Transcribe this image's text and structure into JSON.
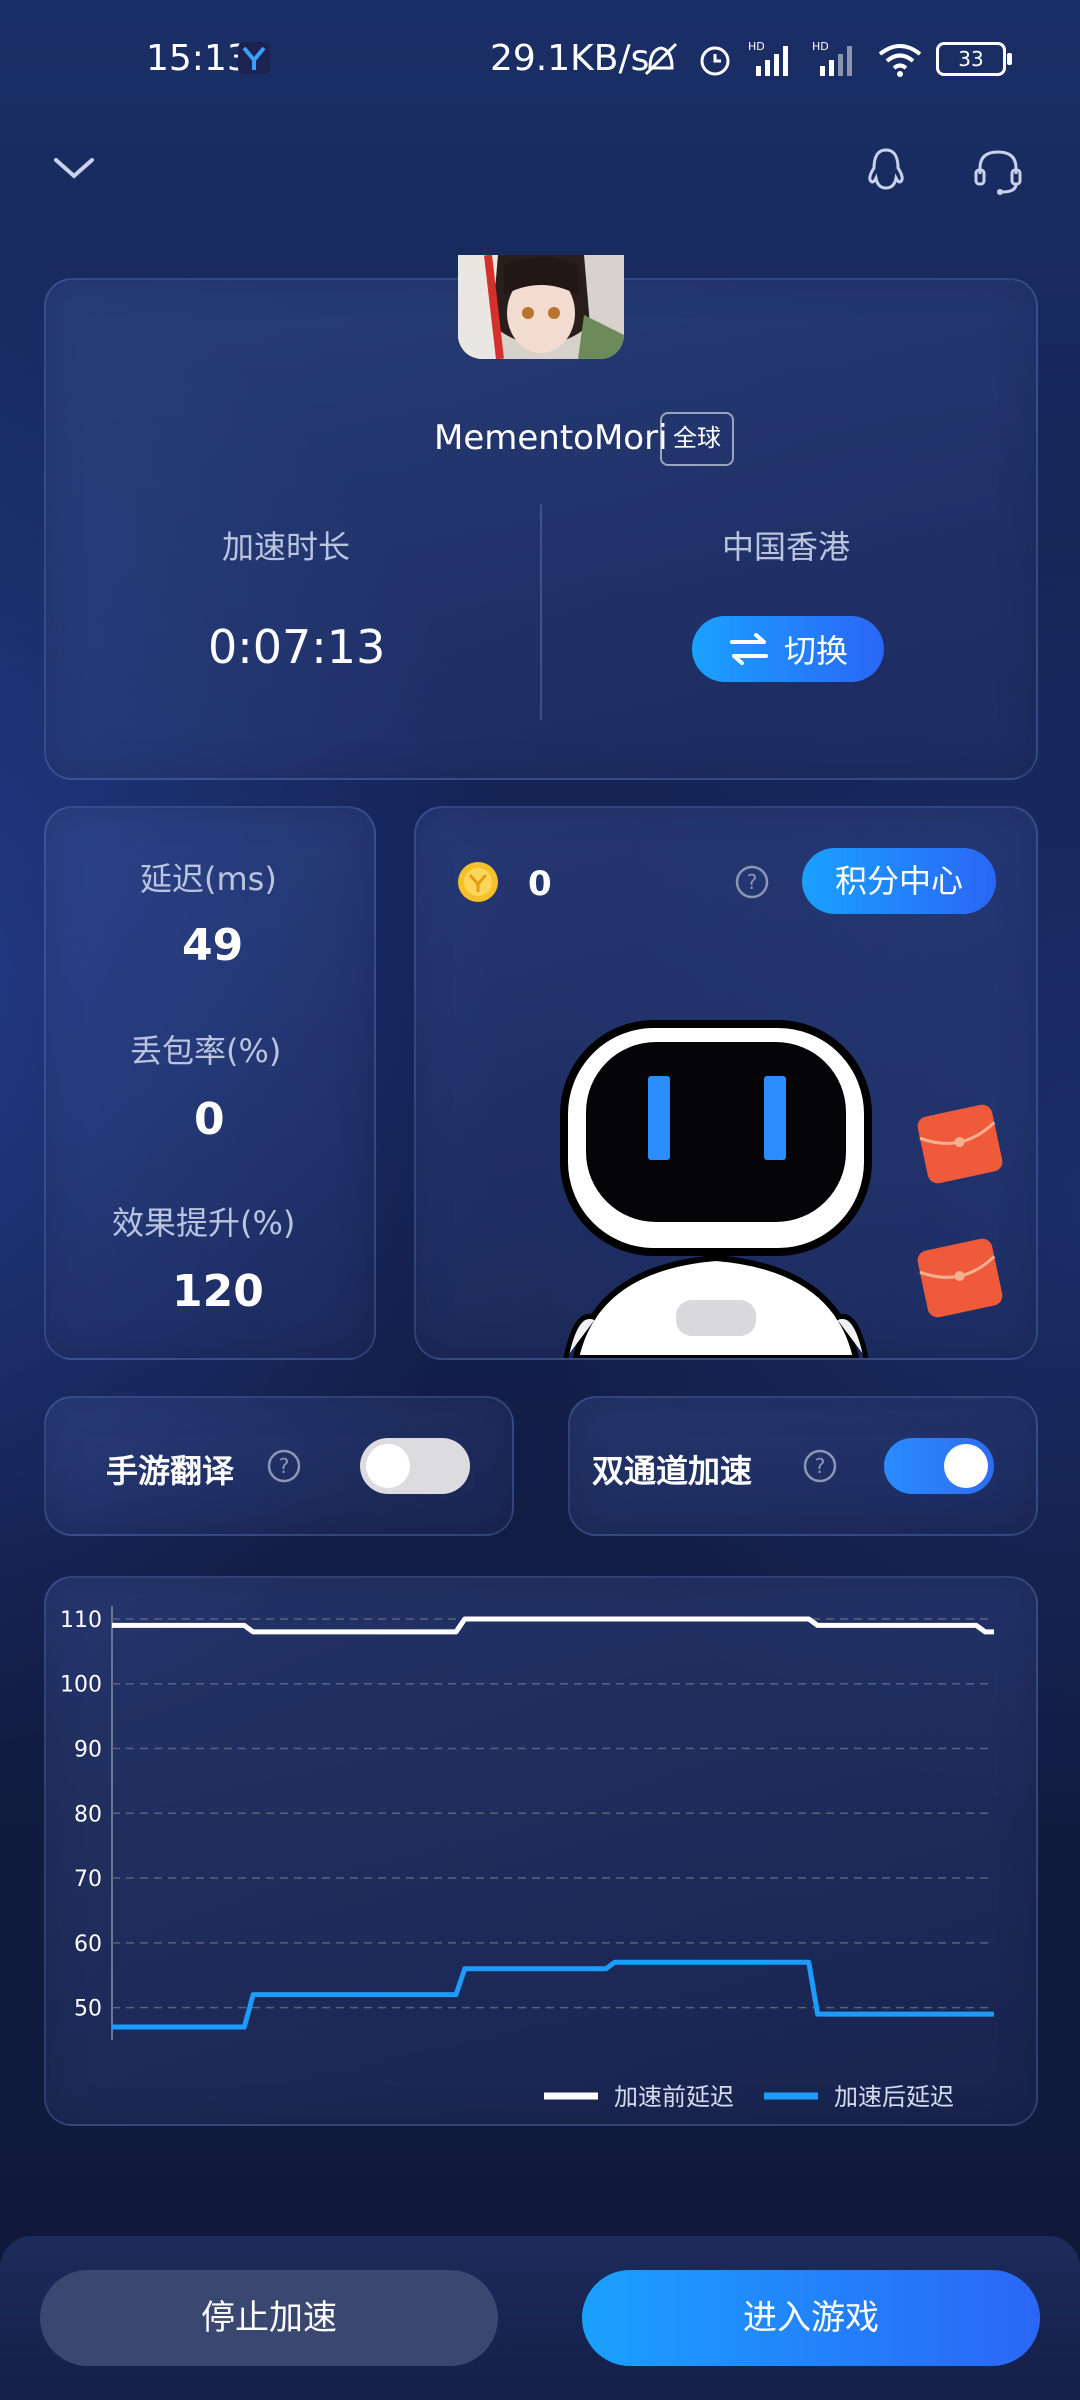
{
  "status_bar": {
    "time": "15:13",
    "net_speed": "29.1KB/s",
    "battery": "33",
    "icons": [
      "mute-alert-icon",
      "alarm-icon",
      "signal-hd-icon",
      "signal-hd-icon",
      "wifi-icon",
      "battery-icon"
    ]
  },
  "header": {
    "back_icon": "chevron-down-icon",
    "qq_icon": "penguin-icon",
    "service_icon": "headset-icon"
  },
  "game": {
    "name": "MementoMori",
    "region_tag": "全球",
    "duration_label": "加速时长",
    "duration_value": "0:07:13",
    "node_label": "中国香港",
    "switch_label": "切换"
  },
  "stats": {
    "latency_label": "延迟(ms)",
    "latency_value": "49",
    "loss_label": "丢包率(%)",
    "loss_value": "0",
    "boost_label": "效果提升(%)",
    "boost_value": "120"
  },
  "points": {
    "value": "0",
    "center_label": "积分中心"
  },
  "toggles": {
    "translate_label": "手游翻译",
    "translate_on": false,
    "dual_label": "双通道加速",
    "dual_on": true
  },
  "chart_data": {
    "type": "line",
    "ylim": [
      45,
      112
    ],
    "yticks": [
      110,
      100,
      90,
      80,
      70,
      60,
      50
    ],
    "x": [
      0,
      15,
      16,
      39,
      40,
      56,
      57,
      79,
      80,
      98,
      99,
      100
    ],
    "series": [
      {
        "name": "加速前延迟",
        "color": "#ffffff",
        "values": [
          109,
          109,
          108,
          108,
          110,
          110,
          110,
          110,
          109,
          109,
          108,
          108
        ]
      },
      {
        "name": "加速后延迟",
        "color": "#1e9bff",
        "values": [
          47,
          47,
          52,
          52,
          56,
          56,
          57,
          57,
          49,
          49,
          49,
          49
        ]
      }
    ]
  },
  "actions": {
    "stop_label": "停止加速",
    "enter_label": "进入游戏"
  }
}
